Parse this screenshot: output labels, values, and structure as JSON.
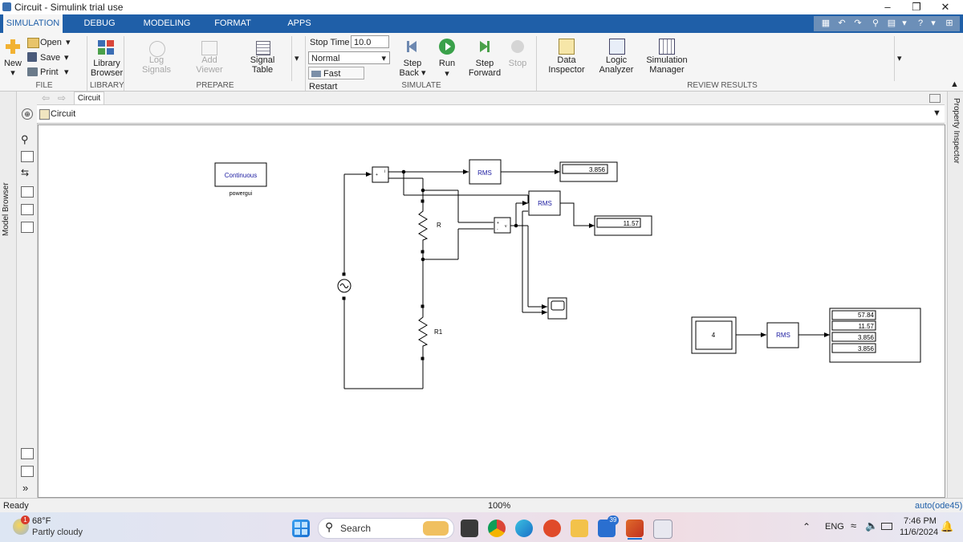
{
  "window": {
    "title": "Circuit - Simulink trial use"
  },
  "tabs": [
    "SIMULATION",
    "DEBUG",
    "MODELING",
    "FORMAT",
    "APPS"
  ],
  "ribbon": {
    "file": {
      "new": "New",
      "open": "Open",
      "save": "Save",
      "print": "Print",
      "group": "FILE"
    },
    "library": {
      "browser": "Library Browser",
      "browser_line1": "Library",
      "browser_line2": "Browser",
      "group": "LIBRARY"
    },
    "prepare": {
      "log1": "Log",
      "log2": "Signals",
      "add1": "Add",
      "add2": "Viewer",
      "sig1": "Signal",
      "sig2": "Table",
      "group": "PREPARE"
    },
    "simulate": {
      "stop_time_label": "Stop Time",
      "stop_time_value": "10.0",
      "mode": "Normal",
      "fast_restart": "Fast Restart",
      "step_back1": "Step",
      "step_back2": "Back",
      "run": "Run",
      "step_fwd1": "Step",
      "step_fwd2": "Forward",
      "stop": "Stop",
      "group": "SIMULATE"
    },
    "review": {
      "data1": "Data",
      "data2": "Inspector",
      "logic1": "Logic",
      "logic2": "Analyzer",
      "simmgr1": "Simulation",
      "simmgr2": "Manager",
      "group": "REVIEW RESULTS"
    }
  },
  "nav": {
    "breadcrumb": "Circuit",
    "address": "Circuit"
  },
  "side": {
    "model_browser": "Model Browser",
    "property_inspector": "Property Inspector"
  },
  "diagram": {
    "powergui_text": "Continuous",
    "powergui_label": "powergui",
    "rms_label": "RMS",
    "display1": "3.856",
    "display2": "11.57",
    "resistor1": "R",
    "resistor2": "R1",
    "constant": "4",
    "display_multi": [
      "57.84",
      "11.57",
      "3.856",
      "3.856"
    ]
  },
  "status": {
    "left": "Ready",
    "zoom": "100%",
    "solver": "auto(ode45)"
  },
  "taskbar": {
    "temp": "68°F",
    "weather": "Partly cloudy",
    "weather_badge": "1",
    "search": "Search",
    "mail_badge": "39",
    "lang": "ENG",
    "time": "7:46 PM",
    "date": "11/6/2024"
  },
  "colors": {
    "accent": "#1f5fa8",
    "block_text": "#1a1aa0"
  }
}
